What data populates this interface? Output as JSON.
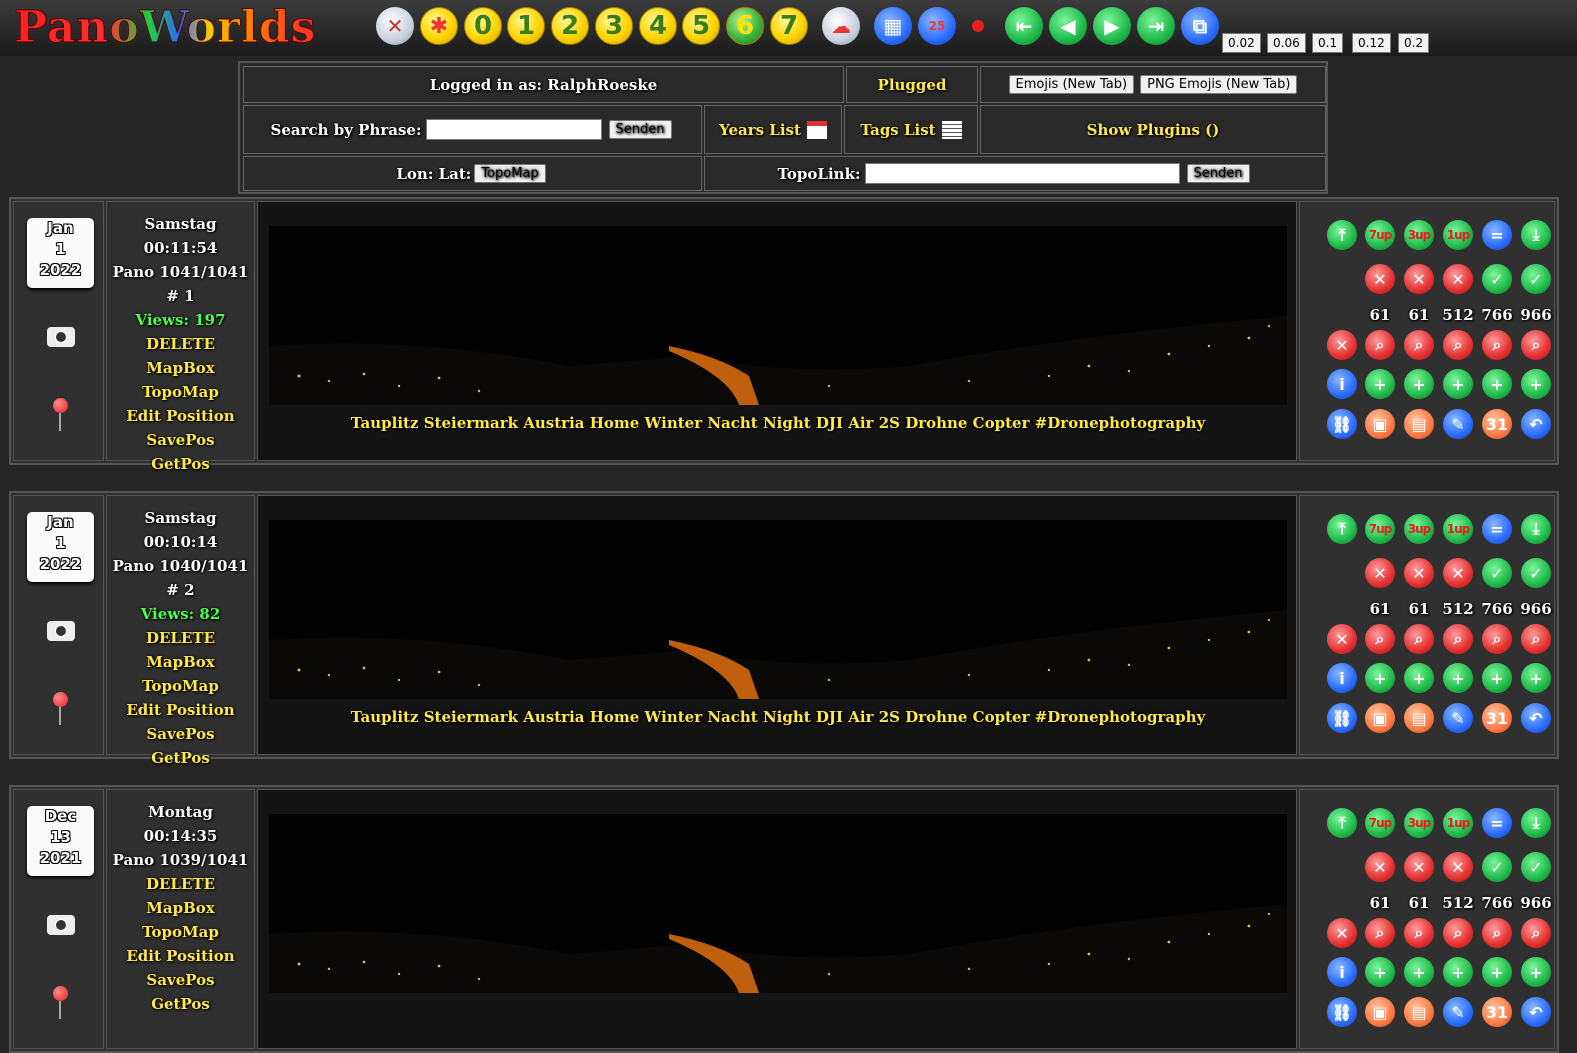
{
  "logo": "PanoWorlds",
  "topbar": {
    "numbers": [
      "0",
      "1",
      "2",
      "3",
      "4",
      "5",
      "6",
      "7"
    ],
    "scales": [
      "0.02",
      "0.06",
      "0.1",
      "0.12",
      "0.2"
    ],
    "badge": "25"
  },
  "control": {
    "logged_in": "Logged in as: RalphRoeske",
    "plugged": "Plugged",
    "emojis_btn": "Emojis (New Tab)",
    "png_emojis_btn": "PNG Emojis (New Tab)",
    "search_label": "Search by Phrase:",
    "send": "Senden",
    "years_list": "Years List",
    "tags_list": "Tags List",
    "show_plugins": "Show Plugins ()",
    "lonlat": "Lon: Lat:",
    "topomap_btn": "TopoMap",
    "topolink": "TopoLink:"
  },
  "entries": [
    {
      "month": "Jan",
      "day": "1",
      "year": "2022",
      "weekday": "Samstag",
      "time": "00:11:54",
      "pano": "Pano 1041/1041",
      "index": "# 1",
      "views": "Views: 197",
      "caption": "Tauplitz Steiermark Austria Home Winter Nacht Night DJI Air 2S Drohne Copter #Dronephotography"
    },
    {
      "month": "Jan",
      "day": "1",
      "year": "2022",
      "weekday": "Samstag",
      "time": "00:10:14",
      "pano": "Pano 1040/1041",
      "index": "# 2",
      "views": "Views: 82",
      "caption": "Tauplitz Steiermark Austria Home Winter Nacht Night DJI Air 2S Drohne Copter #Dronephotography"
    },
    {
      "month": "Dec",
      "day": "13",
      "year": "2021",
      "weekday": "Montag",
      "time": "00:14:35",
      "pano": "Pano 1039/1041",
      "index": "",
      "views": "",
      "caption": ""
    }
  ],
  "actions": {
    "delete": "DELETE",
    "mapbox": "MapBox TopoMap",
    "edit_position": "Edit Position",
    "savepos": "SavePos",
    "getpos": "GetPos"
  },
  "buttons": {
    "up7": "7up",
    "up3": "3up",
    "up1": "1up",
    "eq": "=",
    "plus": "+",
    "info": "i",
    "cal31": "31"
  },
  "counts": [
    "61",
    "61",
    "512",
    "766",
    "966"
  ]
}
